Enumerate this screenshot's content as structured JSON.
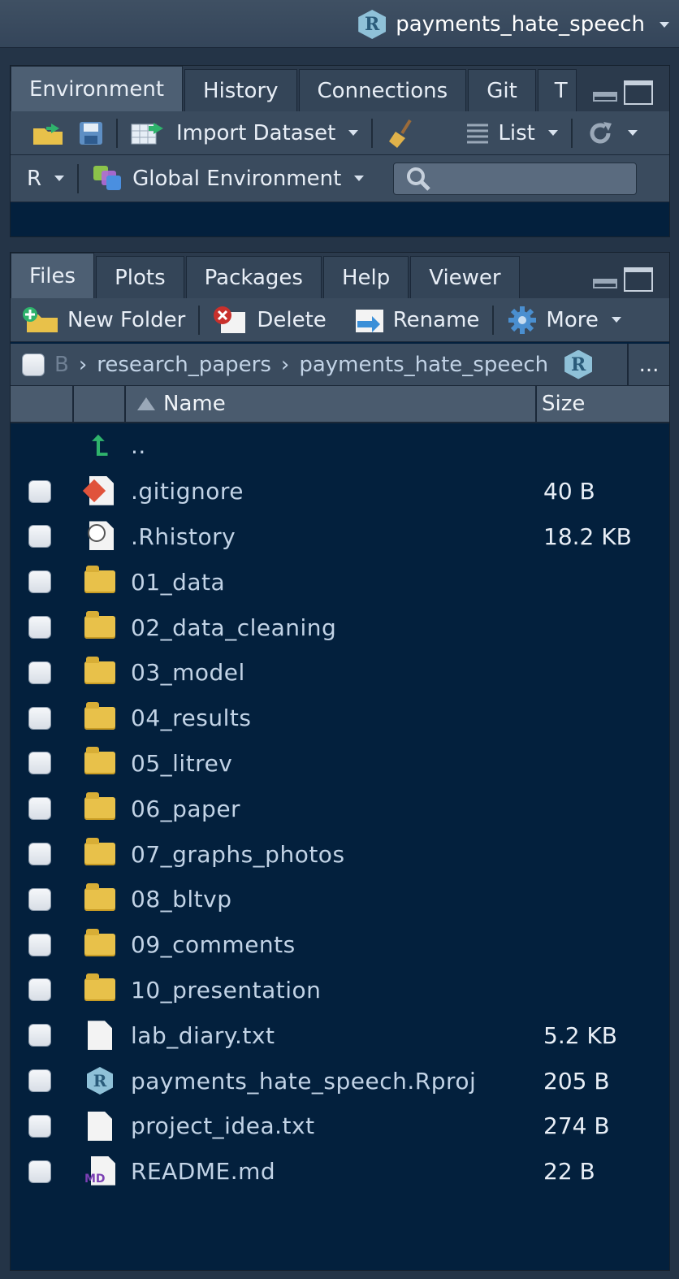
{
  "project": {
    "name": "payments_hate_speech"
  },
  "env_pane": {
    "tabs": [
      "Environment",
      "History",
      "Connections",
      "Git",
      "T"
    ],
    "toolbar": {
      "import_label": "Import Dataset",
      "view_label": "List"
    },
    "toolbar2": {
      "language": "R",
      "environment": "Global Environment",
      "search_placeholder": ""
    }
  },
  "files_pane": {
    "tabs": [
      "Files",
      "Plots",
      "Packages",
      "Help",
      "Viewer"
    ],
    "toolbar": {
      "new_folder": "New Folder",
      "delete": "Delete",
      "rename": "Rename",
      "more": "More"
    },
    "breadcrumb": {
      "hidden": "B",
      "parts": [
        "research_papers",
        "payments_hate_speech"
      ],
      "overflow": "..."
    },
    "columns": {
      "name": "Name",
      "size": "Size"
    },
    "parent_dir": "..",
    "files": [
      {
        "name": ".gitignore",
        "size": "40 B",
        "icon": "git-file-icon"
      },
      {
        "name": ".Rhistory",
        "size": "18.2 KB",
        "icon": "history-file-icon"
      },
      {
        "name": "01_data",
        "size": "",
        "icon": "folder-icon"
      },
      {
        "name": "02_data_cleaning",
        "size": "",
        "icon": "folder-icon"
      },
      {
        "name": "03_model",
        "size": "",
        "icon": "folder-icon"
      },
      {
        "name": "04_results",
        "size": "",
        "icon": "folder-icon"
      },
      {
        "name": "05_litrev",
        "size": "",
        "icon": "folder-icon"
      },
      {
        "name": "06_paper",
        "size": "",
        "icon": "folder-icon"
      },
      {
        "name": "07_graphs_photos",
        "size": "",
        "icon": "folder-icon"
      },
      {
        "name": "08_bltvp",
        "size": "",
        "icon": "folder-icon"
      },
      {
        "name": "09_comments",
        "size": "",
        "icon": "folder-icon"
      },
      {
        "name": "10_presentation",
        "size": "",
        "icon": "folder-icon"
      },
      {
        "name": "lab_diary.txt",
        "size": "5.2 KB",
        "icon": "text-file-icon"
      },
      {
        "name": "payments_hate_speech.Rproj",
        "size": "205 B",
        "icon": "rproj-file-icon"
      },
      {
        "name": "project_idea.txt",
        "size": "274 B",
        "icon": "text-file-icon"
      },
      {
        "name": "README.md",
        "size": "22 B",
        "icon": "markdown-file-icon"
      }
    ]
  },
  "colors": {
    "pane_background": "#03203d",
    "toolbar": "#3a4b5e",
    "link_text": "#c2d3e6",
    "folder": "#e8c14a"
  }
}
